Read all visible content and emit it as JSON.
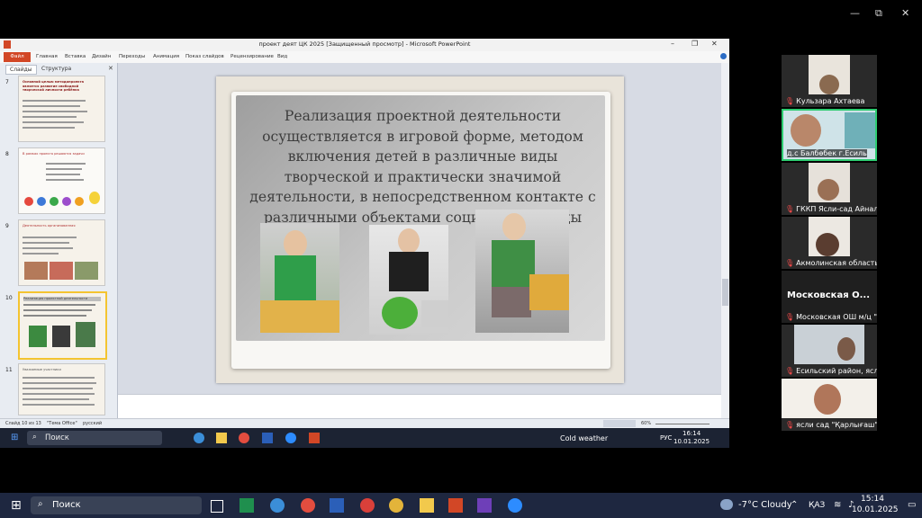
{
  "zoom": {
    "controls": {
      "minimize": "—",
      "maximize": "⧉",
      "close": "✕"
    }
  },
  "ppt": {
    "window_title": "проект деят ЦК 2025 [Защищенный просмотр] - Microsoft PowerPoint",
    "ribbon_tabs": [
      "Файл",
      "Главная",
      "Вставка",
      "Дизайн",
      "Переходы",
      "Анимация",
      "Показ слайдов",
      "Рецензирование",
      "Вид"
    ],
    "panel_tabs": [
      "Слайды",
      "Структура"
    ],
    "thumbnails": [
      {
        "num": "7",
        "title": "Основной целью методопроекта является развитие свободной творческой личности ребёнка"
      },
      {
        "num": "8",
        "title": "В рамках проекта решаются задачи"
      },
      {
        "num": "9",
        "title": "Деятельность организованная"
      },
      {
        "num": "10",
        "title": "Реализация проектной деятельности"
      },
      {
        "num": "11",
        "title": "Уважаемые участники"
      }
    ],
    "status": {
      "slide": "Слайд 10 из 13",
      "theme": "\"Тема Office\"",
      "lang": "русский",
      "zoom": "60%"
    },
    "slide_text": "Реализация проектной деятельности осуществляется в игровой форме, методом включения детей в различные виды творческой и практически значимой деятельности, в непосредственном контакте с различными объектами социальной среды",
    "remote_taskbar": {
      "search": "Поиск",
      "weather": "Cold weather",
      "lang": "РУС",
      "time": "16:14",
      "date": "10.01.2025"
    }
  },
  "participants": [
    {
      "name": "Кульзара Ахтаева",
      "muted": true
    },
    {
      "name": "д.с Балбөбек г.Есиль",
      "muted": true,
      "active": true
    },
    {
      "name": "ГККП Ясли-сад Айнал...",
      "muted": true
    },
    {
      "name": "Акмолинская область,...",
      "muted": true
    },
    {
      "name": "Московская ОШ м/ц \"...",
      "muted": true,
      "big_label": "Московская О..."
    },
    {
      "name": "Есильский район, ясл...",
      "muted": true
    },
    {
      "name": "ясли сад \"Қарлығаш\"...",
      "muted": true
    }
  ],
  "taskbar": {
    "search": "Поиск",
    "weather": "-7°C  Cloudy",
    "lang": "ҚАЗ",
    "time": "15:14",
    "date": "10.01.2025"
  }
}
